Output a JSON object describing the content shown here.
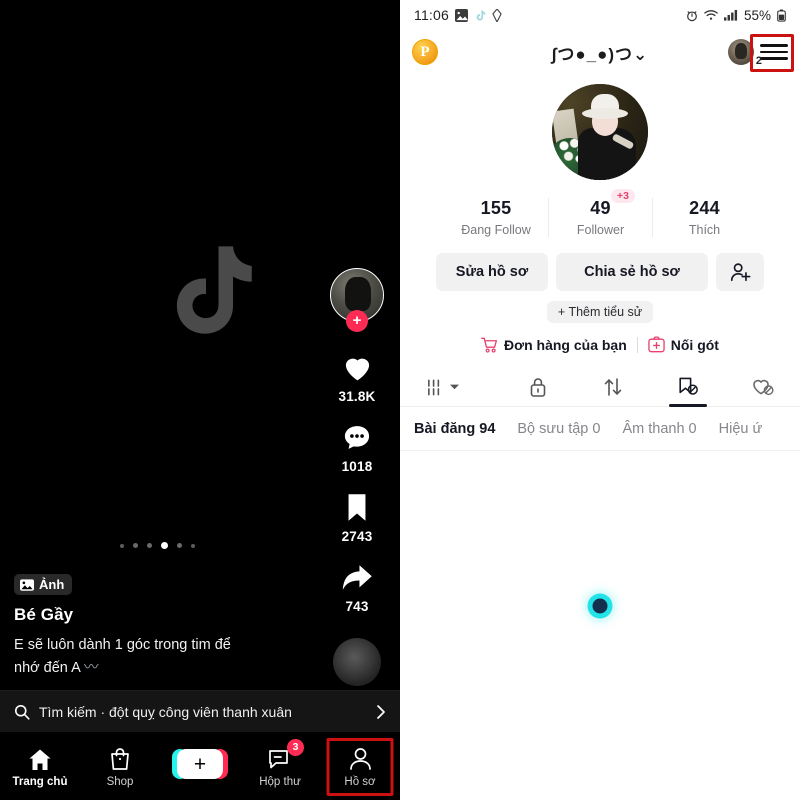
{
  "left_panel": {
    "watermark_icon": "tiktok-logo",
    "action_rail": {
      "follow_plus": "+",
      "likes": {
        "icon": "heart-icon",
        "count": "31.8K"
      },
      "comments": {
        "icon": "comment-icon",
        "count": "1018"
      },
      "saves": {
        "icon": "bookmark-icon",
        "count": "2743"
      },
      "shares": {
        "icon": "share-arrow-icon",
        "count": "743"
      },
      "music_disc_icon": "music-disc-icon"
    },
    "carousel": {
      "total_dots": 6,
      "active_index": 3
    },
    "post": {
      "media_chip_icon": "photo-icon",
      "media_chip_label": "Ảnh",
      "author": "Bé Gầy",
      "caption_line1": "E sẽ luôn dành 1 góc trong tim để",
      "caption_line2": "nhớ đến A",
      "caption_squiggle": "〰"
    },
    "search": {
      "icon": "search-icon",
      "text": "Tìm kiếm · đột quỵ công viên thanh xuân",
      "chevron_icon": "chevron-right-icon"
    },
    "bottom_nav": [
      {
        "icon": "home-icon",
        "label": "Trang chủ",
        "active": true,
        "badge": ""
      },
      {
        "icon": "shop-bag-icon",
        "label": "Shop",
        "active": false,
        "badge": ""
      },
      {
        "icon": "plus-create-icon",
        "label": "",
        "active": false,
        "badge": ""
      },
      {
        "icon": "inbox-message-icon",
        "label": "Hộp thư",
        "active": false,
        "badge": "3"
      },
      {
        "icon": "person-profile-icon",
        "label": "Hồ sơ",
        "active": false,
        "badge": ""
      }
    ]
  },
  "right_panel": {
    "status_bar": {
      "time": "11:06",
      "left_icons": [
        "image-icon",
        "tiktok-note-icon",
        "diamond-icon"
      ],
      "right_icons": [
        "alarm-icon",
        "wifi-icon",
        "signal-icon"
      ],
      "battery_percent": "55%",
      "battery_icon": "battery-icon"
    },
    "topbar": {
      "coin_label": "P",
      "coin_icon": "coin-p-icon",
      "username": "∫つ●_●)つ⌄",
      "mini_avatar_icon": "mini-avatar",
      "mini_avatar_badge": "2",
      "menu_icon": "hamburger-menu-icon"
    },
    "avatar_icon": "profile-avatar",
    "stats": [
      {
        "value": "155",
        "label": "Đang Follow",
        "badge": ""
      },
      {
        "value": "49",
        "label": "Follower",
        "badge": "+3"
      },
      {
        "value": "244",
        "label": "Thích",
        "badge": ""
      }
    ],
    "actions": {
      "edit_profile": "Sửa hồ sơ",
      "share_profile": "Chia sẻ hồ sơ",
      "add_friend_icon": "add-person-icon"
    },
    "add_bio": "+ Thêm tiểu sử",
    "quick_links": [
      {
        "icon": "shopping-cart-icon",
        "label": "Đơn hàng của bạn"
      },
      {
        "icon": "add-box-icon",
        "label": "Nối gót"
      }
    ],
    "tab_icons": [
      {
        "icon": "grid-icon",
        "active": false,
        "has_chevron": true
      },
      {
        "icon": "lock-icon",
        "active": false,
        "has_chevron": false
      },
      {
        "icon": "repost-icon",
        "active": false,
        "has_chevron": false
      },
      {
        "icon": "bookmark-slash-icon",
        "active": true,
        "has_chevron": false
      },
      {
        "icon": "heart-slash-icon",
        "active": false,
        "has_chevron": false
      }
    ],
    "sub_tabs": [
      {
        "label": "Bài đăng 94",
        "active": true
      },
      {
        "label": "Bộ sưu tập 0",
        "active": false
      },
      {
        "label": "Âm thanh 0",
        "active": false
      },
      {
        "label": "Hiệu ứ",
        "active": false
      }
    ],
    "loading_icon": "loading-dot"
  },
  "colors": {
    "accent_pink": "#fe2c55",
    "accent_cyan": "#25f4ee",
    "highlight_red": "#cc1111",
    "badge_pink_bg": "#fde8ef",
    "badge_pink_text": "#e8416c",
    "loader_cyan": "#22e3e8",
    "coin_gold": "#f5a623"
  }
}
